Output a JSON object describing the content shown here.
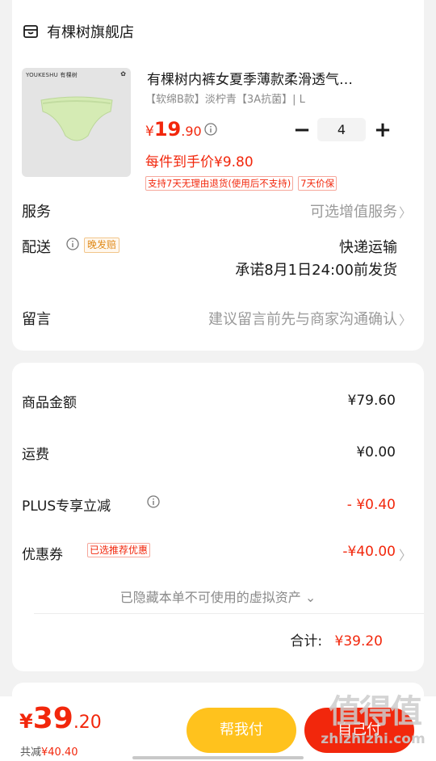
{
  "store": {
    "name": "有棵树旗舰店",
    "icon": "store-icon"
  },
  "product": {
    "brand_mark": "YOUKESHU 有棵树",
    "title": "有棵树内裤女夏季薄款柔滑透气…",
    "spec": "【软绵B款】淡柠青【3A抗菌】| L",
    "price": {
      "currency": "¥",
      "integer": "19",
      "decimal": ".90"
    },
    "per_unit": "每件到手价¥9.80",
    "tags": [
      "支持7天无理由退货(使用后不支持)",
      "7天价保"
    ],
    "quantity": "4",
    "minus": "−",
    "plus": "+"
  },
  "service": {
    "label": "服务",
    "value": "可选增值服务",
    "chevron": "〉"
  },
  "delivery": {
    "label": "配送",
    "late_tag": "晚发赔",
    "method": "快递运输",
    "promise": "承诺8月1日24:00前发货"
  },
  "message": {
    "label": "留言",
    "placeholder": "建议留言前先与商家沟通确认",
    "chevron": "〉"
  },
  "summary": {
    "goods_label": "商品金额",
    "goods_value": "¥79.60",
    "shipping_label": "运费",
    "shipping_value": "¥0.00",
    "plus_label": "PLUS专享立减",
    "plus_value": "- ¥0.40",
    "coupon_label": "优惠券",
    "coupon_tag": "已选推荐优惠",
    "coupon_value": "-¥40.00",
    "coupon_chevron": "〉",
    "hidden_assets": "已隐藏本单不可使用的虚拟资产 ⌄",
    "total_label": "合计:",
    "total_value": "¥39.20"
  },
  "footer": {
    "price": {
      "currency": "¥",
      "integer": "39",
      "decimal": ".20"
    },
    "saved_label": "共减",
    "saved_value": "¥40.40",
    "help_pay": "帮我付",
    "self_pay": "自己付"
  },
  "watermark": {
    "text": "值得值",
    "url": "zhizhizhi.com"
  },
  "colors": {
    "accent_red": "#f2270c",
    "help_yellow": "#ffc21d",
    "late_orange": "#e08a1a"
  }
}
